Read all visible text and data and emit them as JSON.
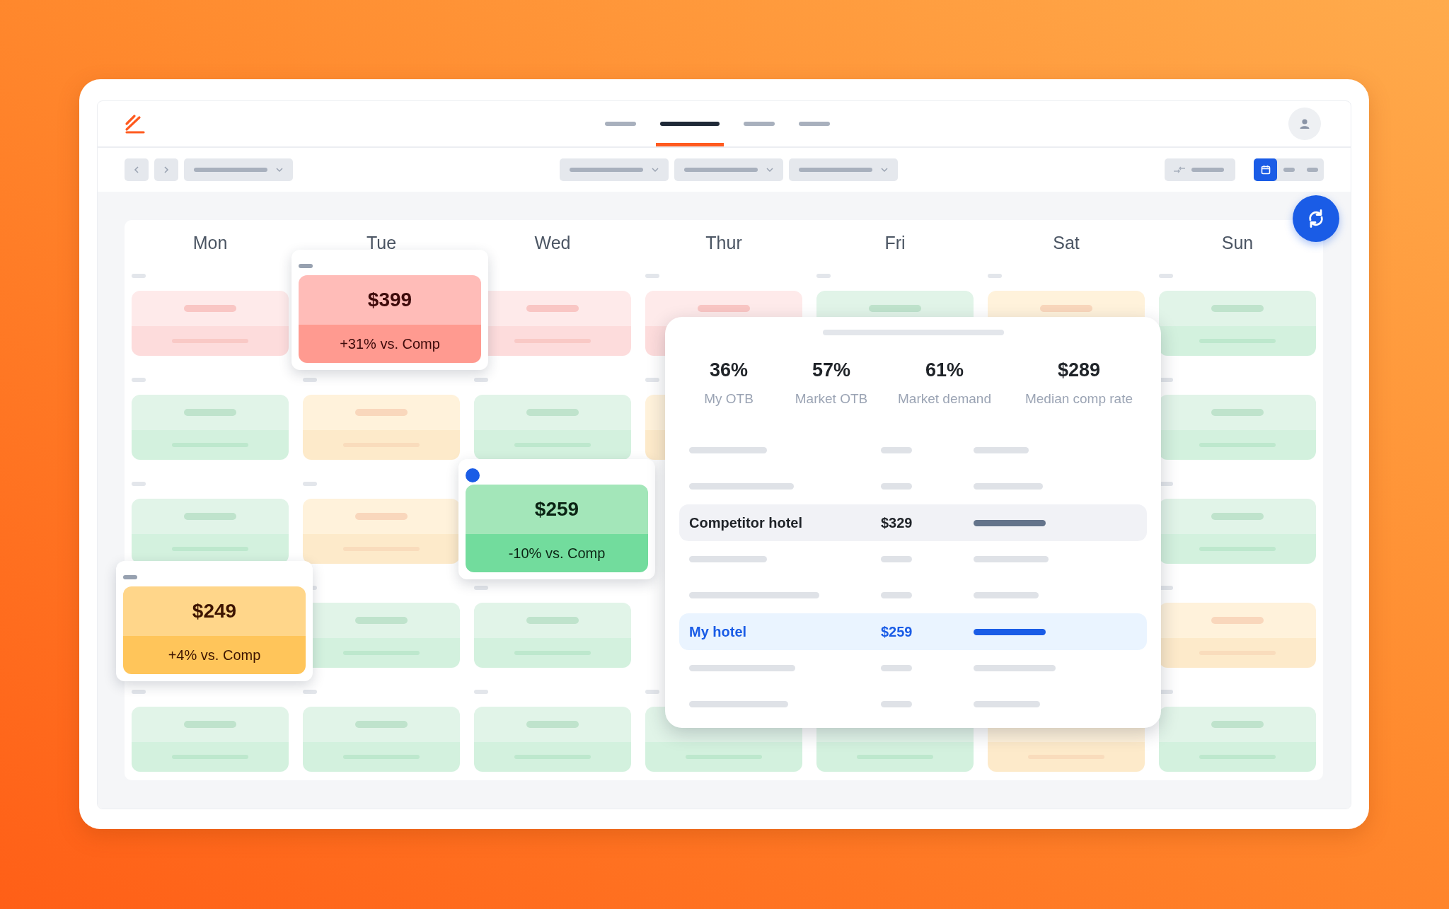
{
  "nav_tabs": [
    {
      "selected": false
    },
    {
      "selected": true
    },
    {
      "selected": false
    },
    {
      "selected": false
    }
  ],
  "view_toggle": [
    {
      "selected": true
    },
    {
      "selected": false
    },
    {
      "selected": false
    }
  ],
  "calendar": {
    "days": [
      "Mon",
      "Tue",
      "Wed",
      "Thur",
      "Fri",
      "Sat",
      "Sun"
    ],
    "weeks": [
      {
        "cells": [
          {
            "kind": "above"
          },
          {
            "kind": "covered"
          },
          {
            "kind": "above"
          },
          {
            "kind": "above"
          },
          {
            "kind": "below"
          },
          {
            "kind": "near"
          },
          {
            "kind": "below"
          }
        ]
      },
      {
        "cells": [
          {
            "kind": "below"
          },
          {
            "kind": "near"
          },
          {
            "kind": "below"
          },
          {
            "kind": "near"
          },
          {
            "kind": "covered"
          },
          {
            "kind": "covered"
          },
          {
            "kind": "below"
          }
        ]
      },
      {
        "cells": [
          {
            "kind": "below"
          },
          {
            "kind": "near"
          },
          {
            "kind": "covered"
          },
          {
            "kind": "covered"
          },
          {
            "kind": "covered"
          },
          {
            "kind": "covered"
          },
          {
            "kind": "below"
          }
        ]
      },
      {
        "cells": [
          {
            "kind": "covered"
          },
          {
            "kind": "below"
          },
          {
            "kind": "below"
          },
          {
            "kind": "covered"
          },
          {
            "kind": "covered"
          },
          {
            "kind": "covered"
          },
          {
            "kind": "near"
          }
        ]
      },
      {
        "cells": [
          {
            "kind": "below"
          },
          {
            "kind": "below"
          },
          {
            "kind": "below"
          },
          {
            "kind": "below"
          },
          {
            "kind": "below"
          },
          {
            "kind": "near"
          },
          {
            "kind": "below"
          }
        ]
      }
    ]
  },
  "rate_cards": [
    {
      "kind": "above",
      "selected": false,
      "price": "$399",
      "delta": "+31% vs. Comp"
    },
    {
      "kind": "below",
      "selected": true,
      "price": "$259",
      "delta": "-10% vs. Comp"
    },
    {
      "kind": "near",
      "selected": false,
      "price": "$249",
      "delta": "+4% vs. Comp"
    }
  ],
  "detail_panel": {
    "stats": [
      {
        "value": "36%",
        "label": "My OTB"
      },
      {
        "value": "57%",
        "label": "Market OTB"
      },
      {
        "value": "61%",
        "label": "Market demand"
      },
      {
        "value": "$289",
        "label": "Median comp rate"
      }
    ],
    "rows": [
      {
        "kind": "placeholder"
      },
      {
        "kind": "placeholder"
      },
      {
        "kind": "competitor",
        "name": "Competitor hotel",
        "price": "$329"
      },
      {
        "kind": "placeholder"
      },
      {
        "kind": "placeholder"
      },
      {
        "kind": "mine",
        "name": "My hotel",
        "price": "$259"
      },
      {
        "kind": "placeholder"
      },
      {
        "kind": "placeholder"
      }
    ]
  }
}
